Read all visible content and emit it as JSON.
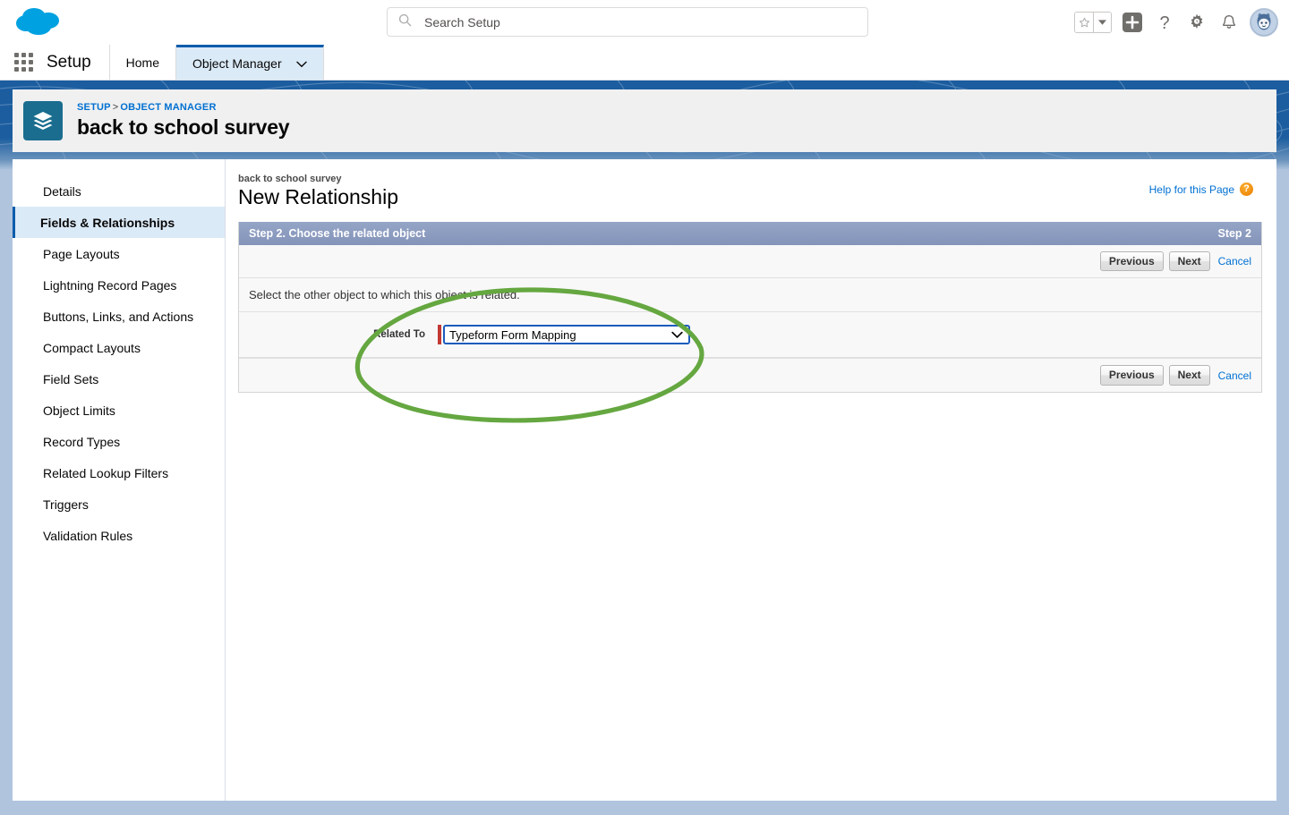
{
  "header": {
    "logo_icon": "salesforce-cloud-logo",
    "search": {
      "placeholder": "Search Setup",
      "value": "",
      "icon": "search-icon"
    },
    "actions": [
      {
        "name": "favorites-star",
        "icon": "star-icon"
      },
      {
        "name": "favorites-dropdown",
        "icon": "caret-down-icon"
      },
      {
        "name": "global-create",
        "icon": "plus-square-icon"
      },
      {
        "name": "help",
        "icon": "question-mark-icon"
      },
      {
        "name": "setup-gear",
        "icon": "gear-icon"
      },
      {
        "name": "notifications",
        "icon": "bell-icon"
      },
      {
        "name": "user-avatar",
        "icon": "avatar-icon"
      }
    ]
  },
  "setup_nav": {
    "app_launcher_icon": "app-launcher-grid-icon",
    "app_name": "Setup",
    "tabs": [
      {
        "label": "Home",
        "active": false,
        "has_caret": false
      },
      {
        "label": "Object Manager",
        "active": true,
        "has_caret": true
      }
    ]
  },
  "record_header": {
    "object_icon": "custom-object-layers-icon",
    "breadcrumb": {
      "root": "SETUP",
      "separator": ">",
      "parent": "OBJECT MANAGER"
    },
    "title": "back to school survey"
  },
  "sidebar": {
    "items": [
      {
        "label": "Details",
        "active": false
      },
      {
        "label": "Fields & Relationships",
        "active": true
      },
      {
        "label": "Page Layouts",
        "active": false
      },
      {
        "label": "Lightning Record Pages",
        "active": false
      },
      {
        "label": "Buttons, Links, and Actions",
        "active": false
      },
      {
        "label": "Compact Layouts",
        "active": false
      },
      {
        "label": "Field Sets",
        "active": false
      },
      {
        "label": "Object Limits",
        "active": false
      },
      {
        "label": "Record Types",
        "active": false
      },
      {
        "label": "Related Lookup Filters",
        "active": false
      },
      {
        "label": "Triggers",
        "active": false
      },
      {
        "label": "Validation Rules",
        "active": false
      }
    ]
  },
  "main": {
    "eyebrow": "back to school survey",
    "title": "New Relationship",
    "help_link": {
      "label": "Help for this Page",
      "icon": "help-circle-icon"
    },
    "wizard": {
      "step_title": "Step 2. Choose the related object",
      "step_indicator": "Step 2",
      "instruction": "Select the other object to which this object is related.",
      "buttons": {
        "previous": "Previous",
        "next": "Next",
        "cancel": "Cancel"
      },
      "field": {
        "label": "Related To",
        "required": true,
        "selected_value": "Typeform Form Mapping",
        "caret_icon": "chevron-down-icon"
      }
    }
  },
  "annotation": {
    "shape": "hand-drawn-ellipse",
    "color": "#65a740",
    "target": "related-to-select"
  },
  "colors": {
    "brand_blue": "#1c5d9f",
    "link_blue": "#0070d2",
    "active_tab_blue": "#0b5cab",
    "step_bar": "#8a9bc0",
    "required_red": "#c23934",
    "page_bg": "#b0c4de",
    "object_icon_bg": "#1a6d8f",
    "annotation_green": "#65a740"
  }
}
